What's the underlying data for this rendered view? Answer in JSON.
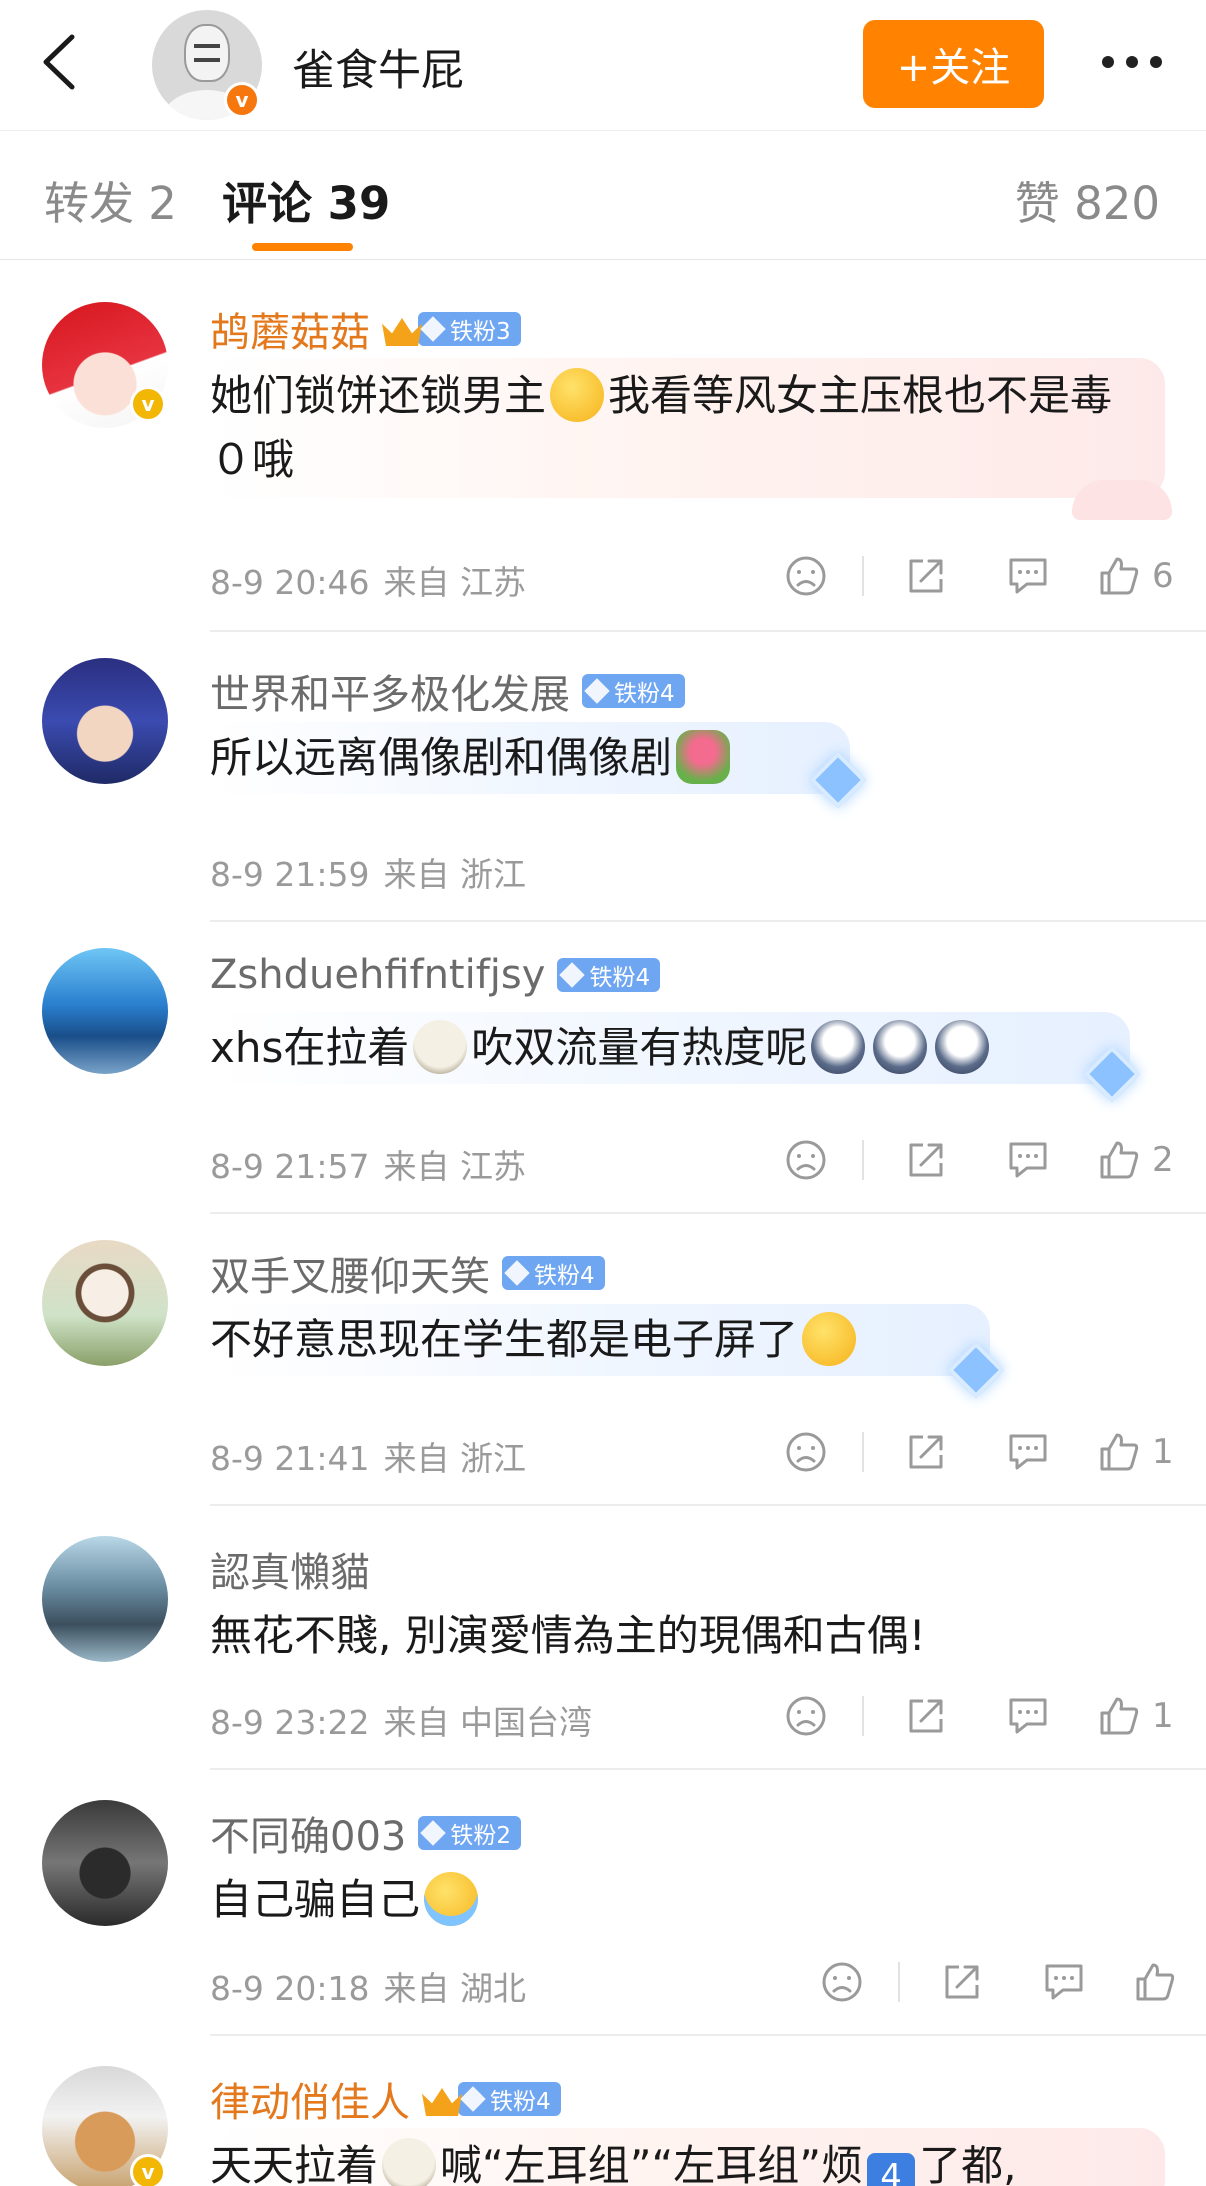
{
  "header": {
    "back_icon": "chevron-left-icon",
    "owner_name": "雀食牛屁",
    "owner_badge": "v",
    "follow_label": "+关注",
    "more_icon": "more-dots-icon"
  },
  "tabs": {
    "repost": "转发 2",
    "comments": "评论 39",
    "likes": "赞 820"
  },
  "colors": {
    "accent": "#ff8200",
    "gold_name": "#e3781c",
    "fan_badge": "#6fa6f2",
    "meta_text": "#9a9a9a"
  },
  "comments": [
    {
      "name": "鸪蘑菇菇",
      "badge": "铁粉3",
      "verified": "v",
      "text_before": "她们锁饼还锁男主",
      "text_after": "我看等风女主压根也不是毒０哦",
      "emoji": "smiling-face-icon",
      "date": "8-9 20:46",
      "from": "来自 江苏",
      "likes": "6"
    },
    {
      "name": "世界和平多极化发展",
      "badge": "铁粉4",
      "text_before": "所以远离偶像剧和偶像剧",
      "emoji": "bouquet-icon",
      "date": "8-9 21:59",
      "from": "来自 浙江"
    },
    {
      "name": "Zshduehfifntifjsy",
      "badge": "铁粉4",
      "text_before": "xhs在拉着",
      "text_after": "吹双流量有热度呢",
      "emoji": "sheep-icon",
      "emoji2": "husky-icon",
      "date": "8-9 21:57",
      "from": "来自 江苏",
      "likes": "2"
    },
    {
      "name": "双手叉腰仰天笑",
      "badge": "铁粉4",
      "text_before": "不好意思现在学生都是电子屏了",
      "emoji": "grinning-face-icon",
      "date": "8-9 21:41",
      "from": "来自 浙江",
      "likes": "1"
    },
    {
      "name": "認真懶貓",
      "text_before": "無花不賤, 別演愛情為主的現偶和古偶!",
      "date": "8-9 23:22",
      "from": "来自 中国台湾",
      "likes": "1"
    },
    {
      "name": "不同确003",
      "badge": "铁粉2",
      "text_before": "自己骗自己",
      "emoji": "crying-face-icon",
      "date": "8-9 20:18",
      "from": "来自 湖北"
    },
    {
      "name": "律动俏佳人",
      "badge": "铁粉4",
      "verified": "v",
      "text_before": "天天拉着",
      "text_mid": "喊“左耳组”“左耳组”烦",
      "num_emoji": "4",
      "text_after": "了都,",
      "emoji": "sheep-icon"
    }
  ]
}
